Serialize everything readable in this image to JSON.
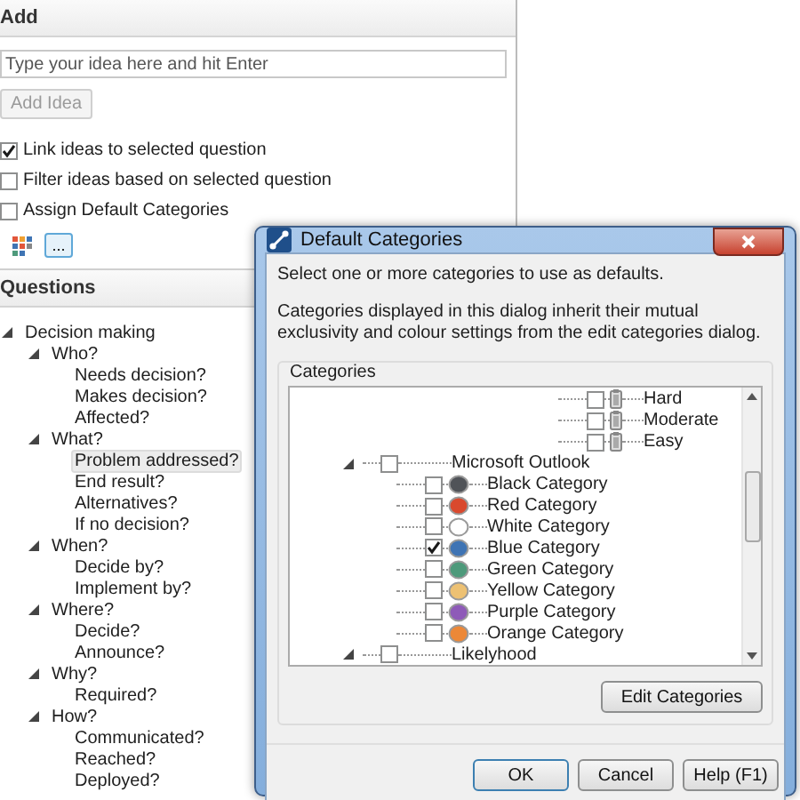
{
  "add_panel": {
    "title": "Add",
    "idea_field": {
      "placeholder": "Type your idea here and hit Enter"
    },
    "add_button": {
      "label": "Add Idea",
      "disabled": true
    },
    "options": [
      {
        "label": "Link ideas to selected question",
        "checked": true
      },
      {
        "label": "Filter ideas based on selected question",
        "checked": false
      },
      {
        "label": "Assign Default Categories",
        "checked": false
      }
    ],
    "more_button": {
      "label": "..."
    }
  },
  "questions_panel": {
    "title": "Questions",
    "tree": [
      {
        "label": "Decision making",
        "expanded": true,
        "selected": false,
        "children": [
          {
            "label": "Who?",
            "expanded": true,
            "selected": false,
            "children": [
              {
                "label": "Needs decision?",
                "selected": false
              },
              {
                "label": "Makes decision?",
                "selected": false
              },
              {
                "label": "Affected?",
                "selected": false
              }
            ]
          },
          {
            "label": "What?",
            "expanded": true,
            "selected": false,
            "children": [
              {
                "label": "Problem addressed?",
                "selected": true
              },
              {
                "label": "End result?",
                "selected": false
              },
              {
                "label": "Alternatives?",
                "selected": false
              },
              {
                "label": "If no decision?",
                "selected": false
              }
            ]
          },
          {
            "label": "When?",
            "expanded": true,
            "selected": false,
            "children": [
              {
                "label": "Decide by?",
                "selected": false
              },
              {
                "label": "Implement by?",
                "selected": false
              }
            ]
          },
          {
            "label": "Where?",
            "expanded": true,
            "selected": false,
            "children": [
              {
                "label": "Decide?",
                "selected": false
              },
              {
                "label": "Announce?",
                "selected": false
              }
            ]
          },
          {
            "label": "Why?",
            "expanded": true,
            "selected": false,
            "children": [
              {
                "label": "Required?",
                "selected": false
              }
            ]
          },
          {
            "label": "How?",
            "expanded": true,
            "selected": false,
            "children": [
              {
                "label": "Communicated?",
                "selected": false
              },
              {
                "label": "Reached?",
                "selected": false
              },
              {
                "label": "Deployed?",
                "selected": false
              }
            ]
          }
        ]
      }
    ]
  },
  "dialog": {
    "title": "Default Categories",
    "intro": "Select one or more categories to use as defaults.",
    "note": "Categories displayed in this dialog inherit their mutual exclusivity and colour settings from the edit categories dialog.",
    "group_title": "Categories",
    "categories": [
      {
        "children": [
          {
            "label": "Hard",
            "kind": "difficulty",
            "checked": false
          },
          {
            "label": "Moderate",
            "kind": "difficulty",
            "checked": false
          },
          {
            "label": "Easy",
            "kind": "difficulty",
            "checked": false
          }
        ]
      },
      {
        "label": "Microsoft Outlook",
        "kind": "group",
        "checked": false,
        "expanded": true,
        "children": [
          {
            "label": "Black Category",
            "kind": "colour",
            "checked": false,
            "color": "#505358"
          },
          {
            "label": "Red Category",
            "kind": "colour",
            "checked": false,
            "color": "#d9492e"
          },
          {
            "label": "White Category",
            "kind": "colour",
            "checked": false,
            "color": "#ffffff"
          },
          {
            "label": "Blue Category",
            "kind": "colour",
            "checked": true,
            "color": "#3f74b4"
          },
          {
            "label": "Green Category",
            "kind": "colour",
            "checked": false,
            "color": "#4e9a7b"
          },
          {
            "label": "Yellow Category",
            "kind": "colour",
            "checked": false,
            "color": "#edc173"
          },
          {
            "label": "Purple Category",
            "kind": "colour",
            "checked": false,
            "color": "#8e5ab8"
          },
          {
            "label": "Orange Category",
            "kind": "colour",
            "checked": false,
            "color": "#ec8838"
          }
        ]
      },
      {
        "label": "Likelyhood",
        "kind": "group",
        "checked": false,
        "expanded": true
      }
    ],
    "edit_button": "Edit Categories",
    "buttons": [
      {
        "label": "OK",
        "default": true
      },
      {
        "label": "Cancel",
        "default": false
      },
      {
        "label": "Help (F1)",
        "default": false
      }
    ]
  }
}
